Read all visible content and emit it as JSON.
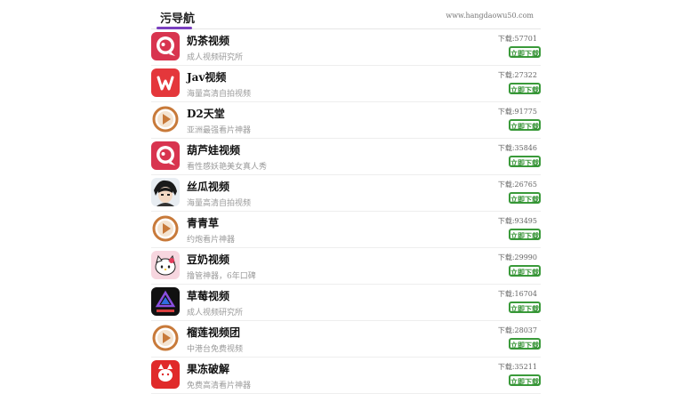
{
  "header": {
    "brand": "污导航",
    "site": "www.hangdaowu50.com"
  },
  "apps": [
    {
      "name": "奶茶视频",
      "desc": "成人视频研究所",
      "count": "下载:57701",
      "button": "立即下载",
      "icon": "pink-chat-icon"
    },
    {
      "name": "Jav视频",
      "desc": "海量高清自拍视频",
      "count": "下载:27322",
      "button": "立即下载",
      "icon": "red-w-icon"
    },
    {
      "name": "D2天堂",
      "desc": "亚洲最强看片神器",
      "count": "下载:91775",
      "button": "立即下载",
      "icon": "orange-play-icon"
    },
    {
      "name": "葫芦娃视频",
      "desc": "看性感妖艳美女真人秀",
      "count": "下载:35846",
      "button": "立即下载",
      "icon": "pink-chat-icon"
    },
    {
      "name": "丝瓜视频",
      "desc": "海量高清自拍视频",
      "count": "下载:26765",
      "button": "立即下载",
      "icon": "anime-avatar-icon"
    },
    {
      "name": "青青草",
      "desc": "约炮看片神器",
      "count": "下载:93495",
      "button": "立即下载",
      "icon": "orange-play-icon"
    },
    {
      "name": "豆奶视频",
      "desc": "撸管神器，6年口碑",
      "count": "下载:29990",
      "button": "立即下载",
      "icon": "cat-face-icon"
    },
    {
      "name": "草莓视频",
      "desc": "成人视频研究所",
      "count": "下载:16704",
      "button": "立即下载",
      "icon": "dark-triangle-icon"
    },
    {
      "name": "榴莲视频团",
      "desc": "中港台免费视频",
      "count": "下载:28037",
      "button": "立即下载",
      "icon": "orange-play-icon"
    },
    {
      "name": "果冻破解",
      "desc": "免费高清看片神器",
      "count": "下载:35211",
      "button": "立即下载",
      "icon": "red-cat-icon"
    }
  ],
  "colors": {
    "accent": "#7a3fbf",
    "button": "#3a9a3a",
    "pink": "#d8344f",
    "red": "#e4373b",
    "orange": "#c87a3a"
  }
}
